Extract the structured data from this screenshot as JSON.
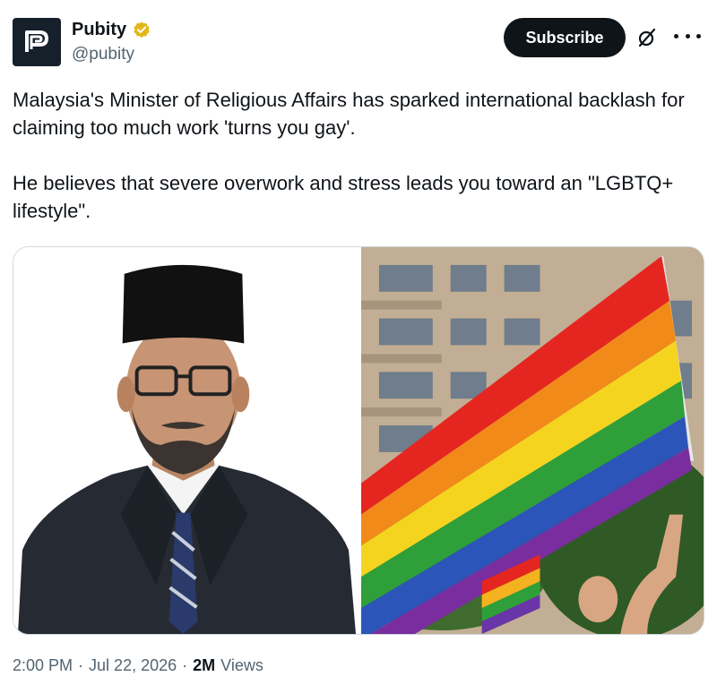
{
  "author": {
    "display_name": "Pubity",
    "handle": "@pubity",
    "verified_badge_color": "#e2b719",
    "avatar_logo_icon": "pubity-p-logo"
  },
  "actions": {
    "subscribe_label": "Subscribe",
    "grok_icon": "grok-slash-circle-icon",
    "more_icon": "more-dots-icon"
  },
  "tweet": {
    "paragraph_1": "Malaysia's Minister of Religious Affairs has sparked international backlash for claiming too much work 'turns you gay'.",
    "paragraph_2": "He believes that severe overwork and stress leads you toward an \"LGBTQ+ lifestyle\"."
  },
  "media": {
    "left_image": "portrait of a man in a black songkok hat, glasses, dark suit and striped tie on white background",
    "right_image": "rainbow pride flags waving in front of a tall apartment building with trees"
  },
  "meta": {
    "time": "2:00 PM",
    "date": "Jul 22, 2026",
    "separator": "·",
    "views_count": "2M",
    "views_label": "Views"
  }
}
